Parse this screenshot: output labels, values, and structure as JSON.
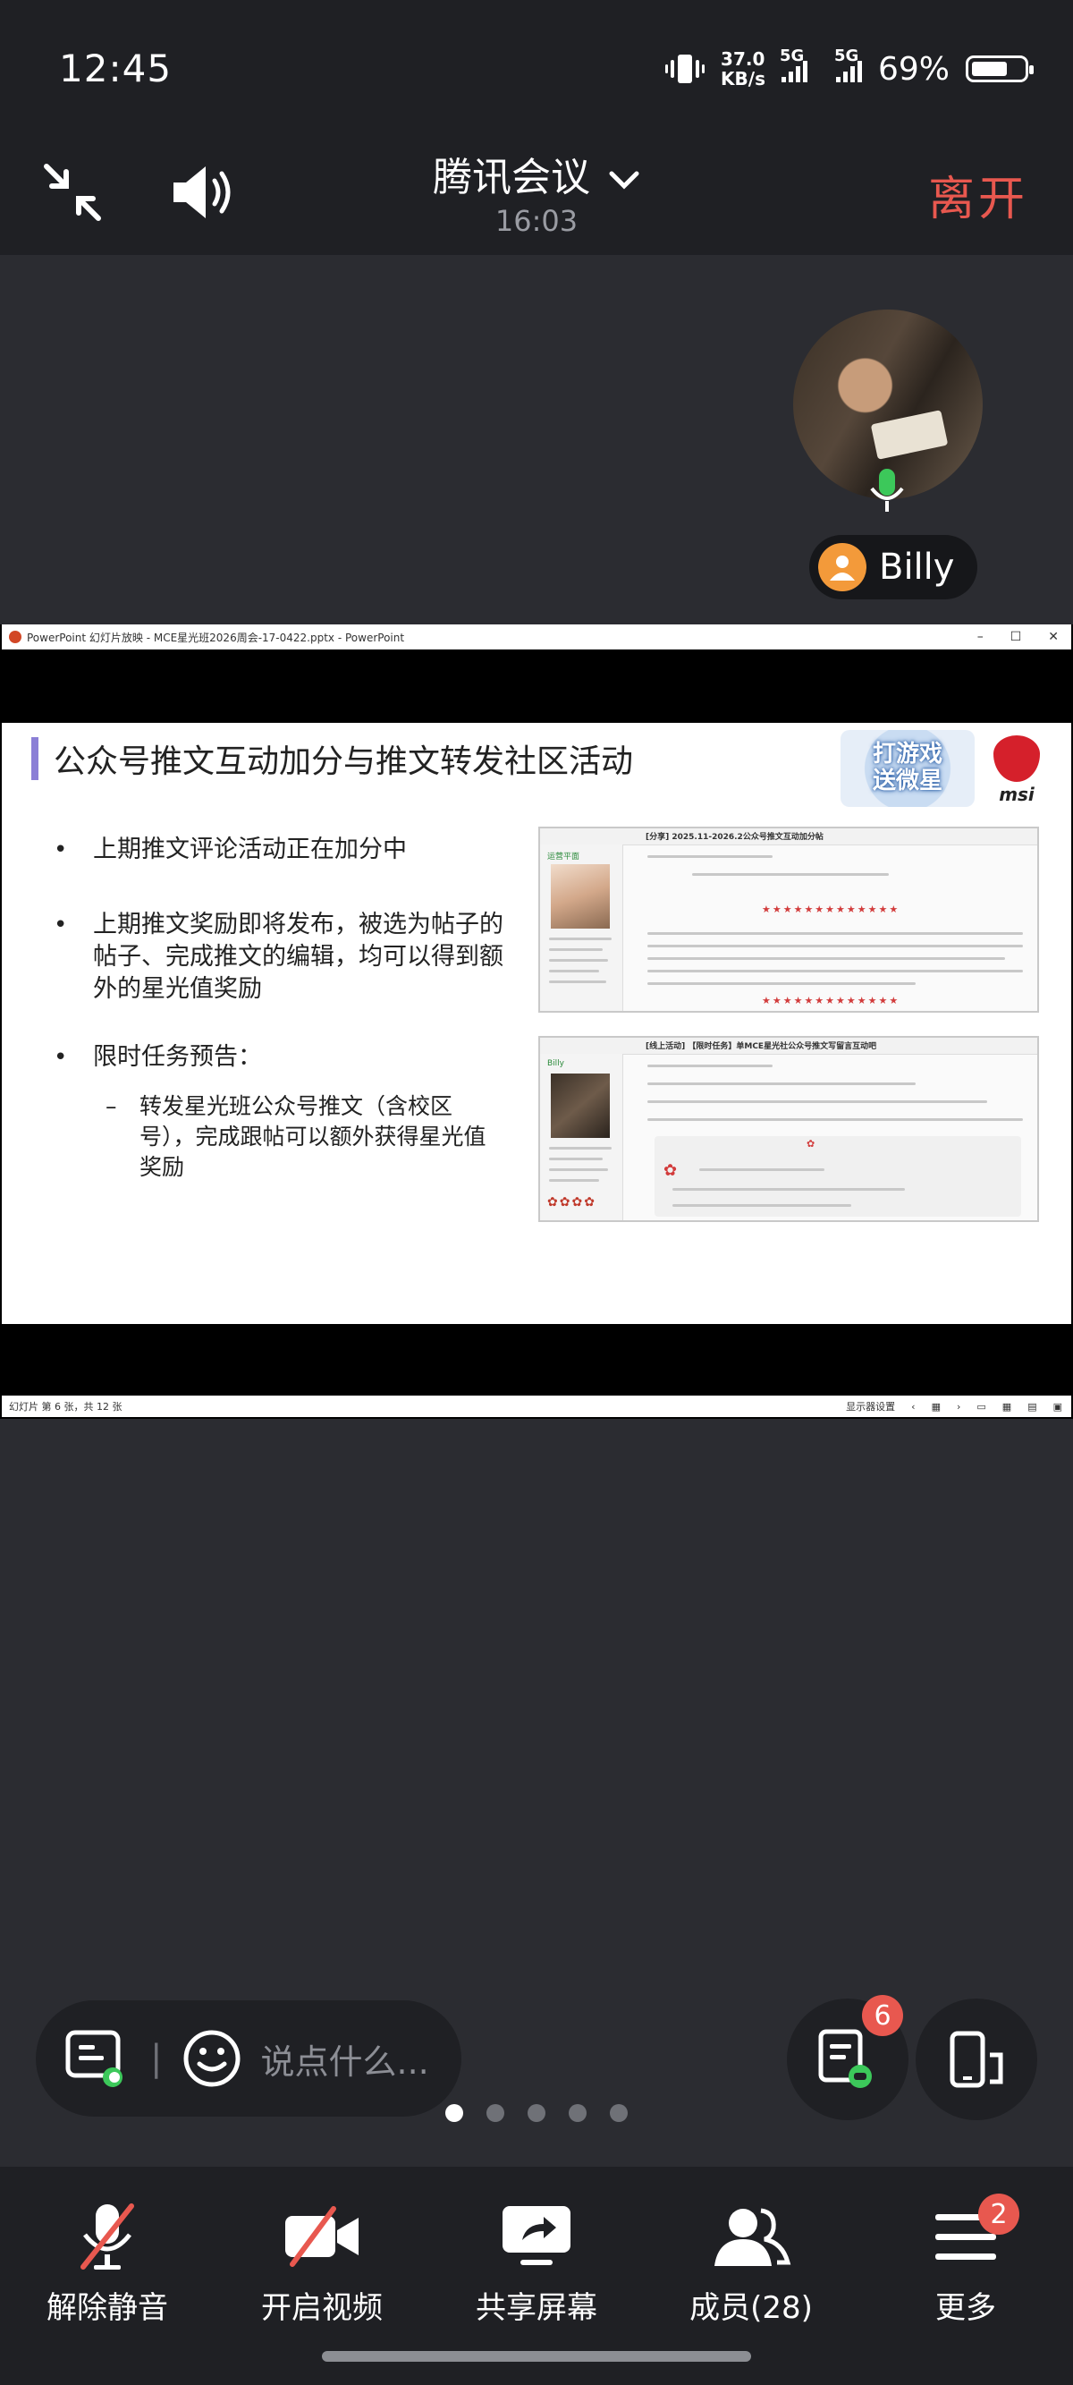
{
  "status_bar": {
    "time": "12:45",
    "net_speed_value": "37.0",
    "net_speed_unit": "KB/s",
    "signal1_label": "5G",
    "signal2_label": "5G",
    "battery_percent": "69%",
    "battery_level": 0.69
  },
  "header": {
    "title": "腾讯会议",
    "timer": "16:03",
    "leave_label": "离开"
  },
  "participant": {
    "name": "Billy",
    "mic_active": true
  },
  "shared_screen": {
    "window_title": "PowerPoint 幻灯片放映 - MCE星光班2026周会-17-0422.pptx - PowerPoint",
    "slide": {
      "title": "公众号推文互动加分与推文转发社区活动",
      "brand_badge": "打游戏\n送微星",
      "brand_logo": "msi",
      "bullets": [
        {
          "text": "上期推文评论活动正在加分中"
        },
        {
          "text": "上期推文奖励即将发布，被选为帖子的帖子、完成推文的编辑，均可以得到额外的星光值奖励"
        },
        {
          "text": "限时任务预告："
        }
      ],
      "sub_bullet": "转发星光班公众号推文（含校区号），完成跟帖可以额外获得星光值奖励",
      "screenshots": [
        {
          "post_title": "[分享] 2025.11-2026.2公众号推文互动加分帖",
          "user": "运营平面"
        },
        {
          "post_title": "[线上活动] 【限时任务】单MCE星光社公众号推文写留言互动吧",
          "user": "Billy"
        }
      ]
    },
    "status_left": "幻灯片 第 6 张，共 12 张",
    "status_right": "显示器设置"
  },
  "chat": {
    "placeholder": "说点什么..."
  },
  "floating": {
    "notes_badge": "6"
  },
  "pager": {
    "count": 5,
    "active_index": 0
  },
  "toolbar": {
    "unmute_label": "解除静音",
    "video_label": "开启视频",
    "share_label": "共享屏幕",
    "members_label": "成员(28)",
    "more_label": "更多",
    "more_badge": "2"
  },
  "colors": {
    "accent_red": "#e8584f",
    "background": "#2b2c31",
    "bar": "#1f2024"
  }
}
